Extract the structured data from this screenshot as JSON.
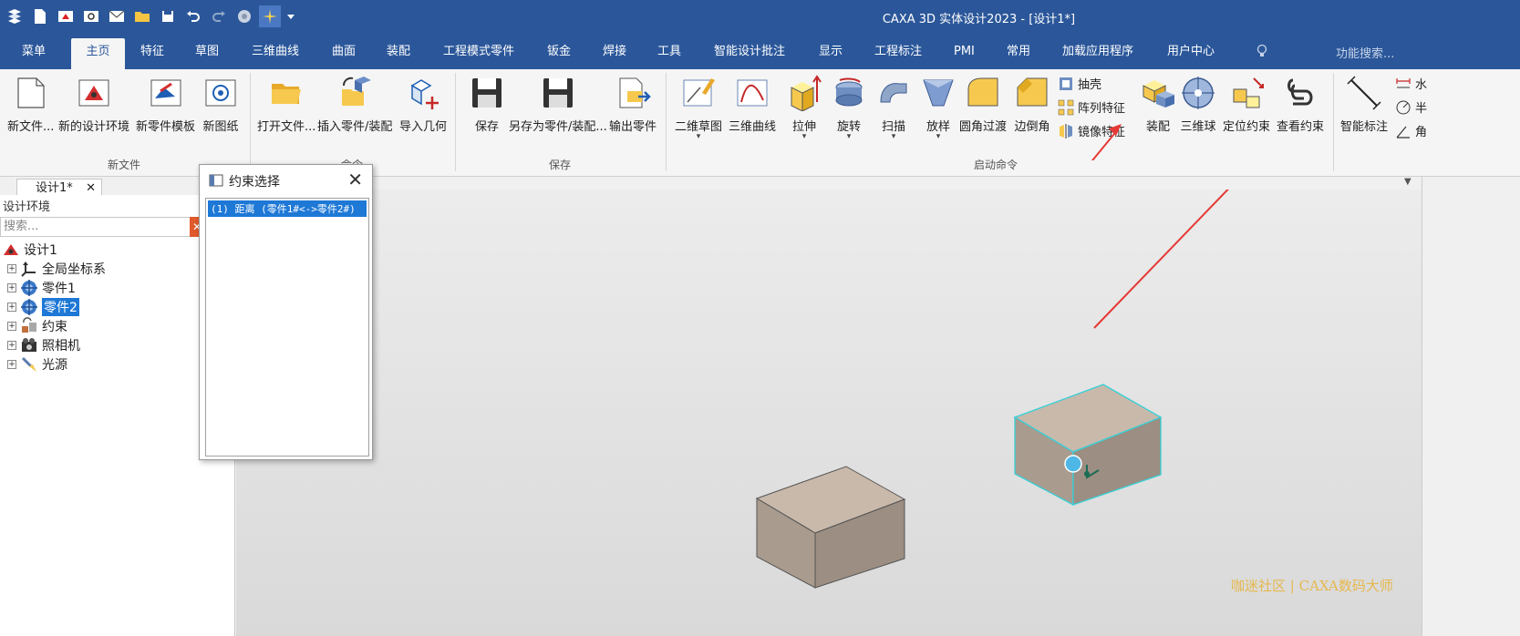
{
  "window": {
    "title": "CAXA 3D 实体设计2023 - [设计1*]"
  },
  "quick_access": [
    "app-menu-icon",
    "new-file-icon",
    "new-design-icon",
    "new-drawing-icon",
    "email-icon",
    "open-folder-icon",
    "save-icon",
    "undo-icon",
    "redo-icon",
    "render-icon",
    "sparkle-icon",
    "customize-icon"
  ],
  "ribbon_tabs": [
    "菜单",
    "主页",
    "特征",
    "草图",
    "三维曲线",
    "曲面",
    "装配",
    "工程模式零件",
    "钣金",
    "焊接",
    "工具",
    "智能设计批注",
    "显示",
    "工程标注",
    "PMI",
    "常用",
    "加载应用程序",
    "用户中心"
  ],
  "search_hint": "功能搜索...",
  "ribbon": {
    "new_file": {
      "group": "新文件",
      "buttons": [
        "新文件...",
        "新的设计环境",
        "新零件模板",
        "新图纸"
      ]
    },
    "command": {
      "group": "命令",
      "buttons": [
        "打开文件...",
        "插入零件/装配",
        "导入几何"
      ]
    },
    "save": {
      "group": "保存",
      "buttons": [
        "保存",
        "另存为零件/装配...",
        "输出零件"
      ]
    },
    "launch": {
      "group": "启动命令",
      "buttons": [
        "二维草图",
        "三维曲线",
        "拉伸",
        "旋转",
        "扫描",
        "放样",
        "圆角过渡",
        "边倒角"
      ],
      "small": [
        "抽壳",
        "阵列特征",
        "镜像特征"
      ],
      "buttons2": [
        "装配",
        "三维球",
        "定位约束",
        "查看约束"
      ]
    },
    "annot": {
      "buttons": [
        "智能标注"
      ],
      "small": [
        "水",
        "半",
        "角"
      ]
    }
  },
  "doc_tab": "设计1*",
  "left_panel": {
    "title": "设计环境",
    "search_placeholder": "搜索...",
    "tree": [
      "设计1",
      "全局坐标系",
      "零件1",
      "零件2",
      "约束",
      "照相机",
      "光源"
    ]
  },
  "dialog": {
    "title": "约束选择",
    "items": [
      "(1) 距离 (零件1#<->零件2#)"
    ]
  },
  "watermark": "咖迷社区 | CAXA数码大师",
  "colors": {
    "titlebar": "#2b579a",
    "selection": "#1e78d6",
    "arrow": "#e53935",
    "highlight_edge": "#35d0d8"
  }
}
